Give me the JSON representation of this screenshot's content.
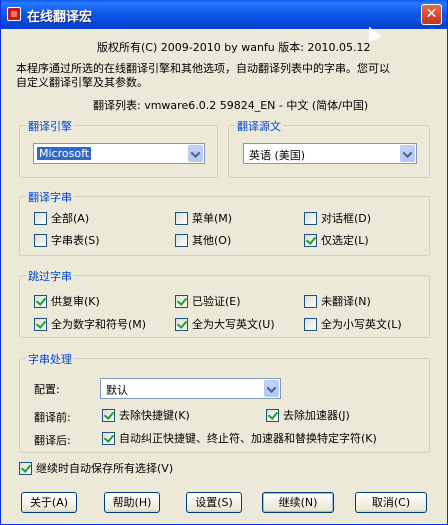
{
  "window": {
    "title": "在线翻译宏",
    "close_glyph": "✕"
  },
  "copyright": "版权所有(C) 2009-2010 by wanfu  版本: 2010.05.12",
  "description_line1": "本程序通过所选的在线翻译引擎和其他选项，自动翻译列表中的字串。您可以",
  "description_line2": "自定义翻译引擎及其参数。",
  "translation_list": "翻译列表: vmware6.0.2 59824_EN - 中文 (简体/中国)",
  "engine": {
    "legend": "翻译引擎",
    "value": "Microsoft"
  },
  "source": {
    "legend": "翻译源文",
    "value": "英语 (美国)"
  },
  "translate_strings": {
    "legend": "翻译字串",
    "items": [
      {
        "label": "全部(A)",
        "checked": false
      },
      {
        "label": "菜单(M)",
        "checked": false
      },
      {
        "label": "对话框(D)",
        "checked": false
      },
      {
        "label": "字串表(S)",
        "checked": false
      },
      {
        "label": "其他(O)",
        "checked": false
      },
      {
        "label": "仅选定(L)",
        "checked": true
      }
    ]
  },
  "skip_strings": {
    "legend": "跳过字串",
    "items": [
      {
        "label": "供复审(K)",
        "checked": true
      },
      {
        "label": "已验证(E)",
        "checked": true
      },
      {
        "label": "未翻译(N)",
        "checked": false
      },
      {
        "label": "全为数字和符号(M)",
        "checked": true
      },
      {
        "label": "全为大写英文(U)",
        "checked": true
      },
      {
        "label": "全为小写英文(L)",
        "checked": false
      }
    ]
  },
  "processing": {
    "legend": "字串处理",
    "config_label": "配置:",
    "config_value": "默认",
    "before_label": "翻译前:",
    "before_items": [
      {
        "label": "去除快捷键(K)",
        "checked": true
      },
      {
        "label": "去除加速器(J)",
        "checked": true
      }
    ],
    "after_label": "翻译后:",
    "after_item": {
      "label": "自动纠正快捷键、终止符、加速器和替换特定字符(K)",
      "checked": true
    }
  },
  "autosave": {
    "label": "继续时自动保存所有选择(V)",
    "checked": true
  },
  "buttons": {
    "about": "关于(A)",
    "help": "帮助(H)",
    "settings": "设置(S)",
    "continue": "继续(N)",
    "cancel": "取消(C)"
  }
}
